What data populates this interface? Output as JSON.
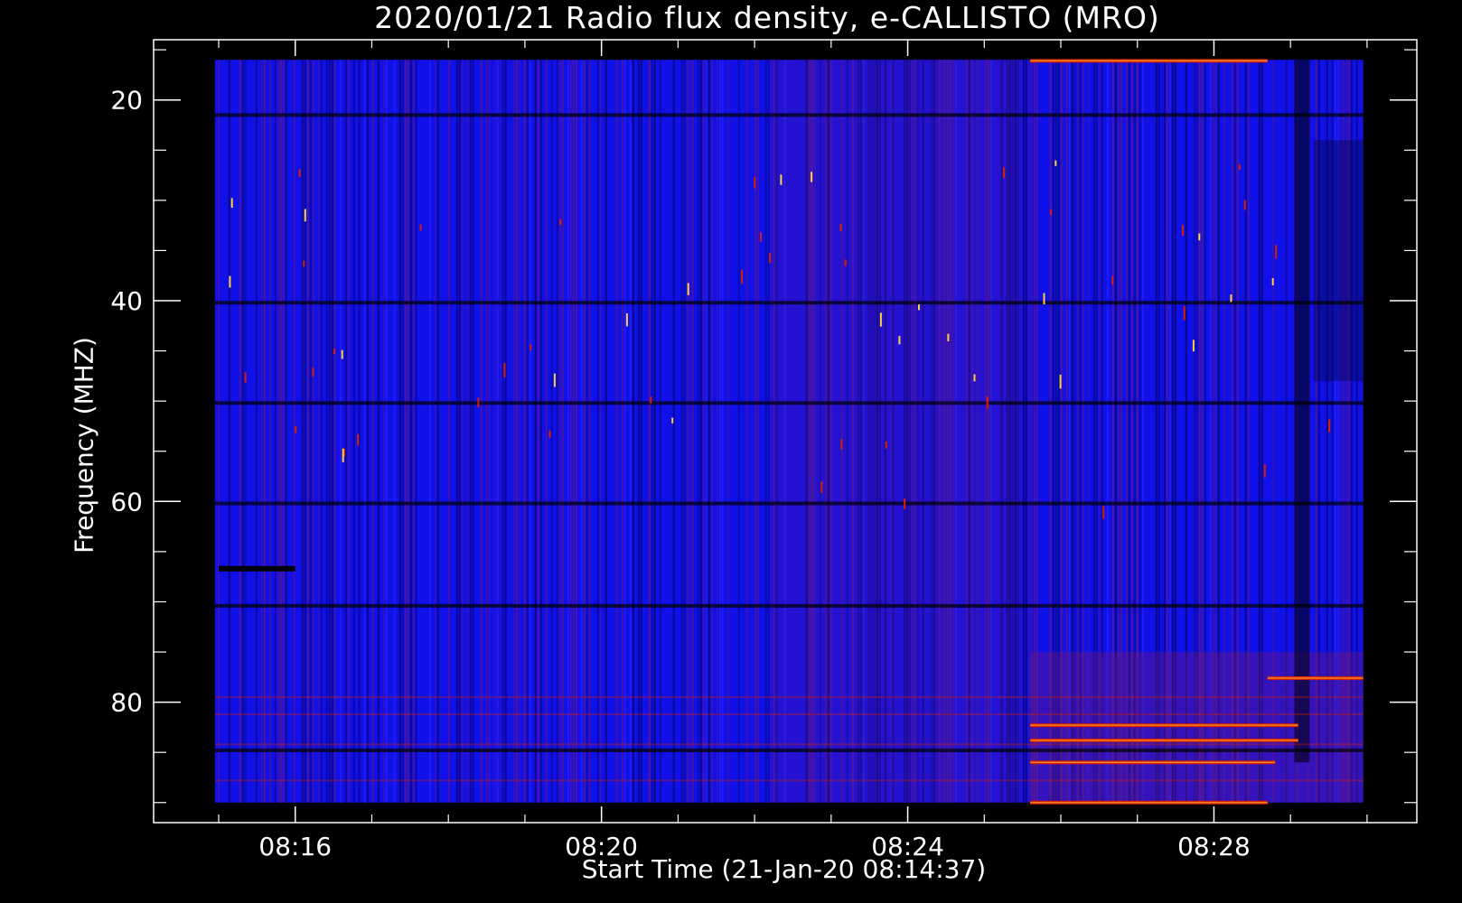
{
  "chart_data": {
    "type": "heatmap",
    "title": "2020/01/21  Radio flux density, e-CALLISTO (MRO)",
    "xlabel": "Start Time (21-Jan-20 08:14:37)",
    "ylabel": "Frequency (MHZ)",
    "x_ticks": [
      "08:16",
      "08:20",
      "08:24",
      "08:28"
    ],
    "x_tick_minutes": [
      16,
      20,
      24,
      28
    ],
    "x_range_minutes": [
      14.15,
      30.65
    ],
    "data_x_range_minutes": [
      14.95,
      29.95
    ],
    "y_ticks": [
      20,
      40,
      60,
      80
    ],
    "ylim": [
      14,
      92
    ],
    "data_y_range": [
      16,
      90
    ],
    "y_inverted": true,
    "colors": {
      "background": "#000000",
      "low": "#1010e8",
      "mid": "#7a1a6a",
      "high": "#d82000",
      "peak": "#ffd040"
    },
    "features": {
      "dark_bands_mhz": [
        21.5,
        40.2,
        50.2,
        60.2,
        70.4,
        84.8
      ],
      "bright_bands_mhz": [
        {
          "f": 16.1,
          "t0": 25.6,
          "t1": 28.7
        },
        {
          "f": 77.6,
          "t0": 28.7,
          "t1": 29.95
        },
        {
          "f": 82.3,
          "t0": 25.6,
          "t1": 29.1
        },
        {
          "f": 83.8,
          "t0": 25.6,
          "t1": 29.1
        },
        {
          "f": 86.0,
          "t0": 25.6,
          "t1": 28.8
        },
        {
          "f": 90.0,
          "t0": 25.6,
          "t1": 28.7
        }
      ]
    }
  }
}
